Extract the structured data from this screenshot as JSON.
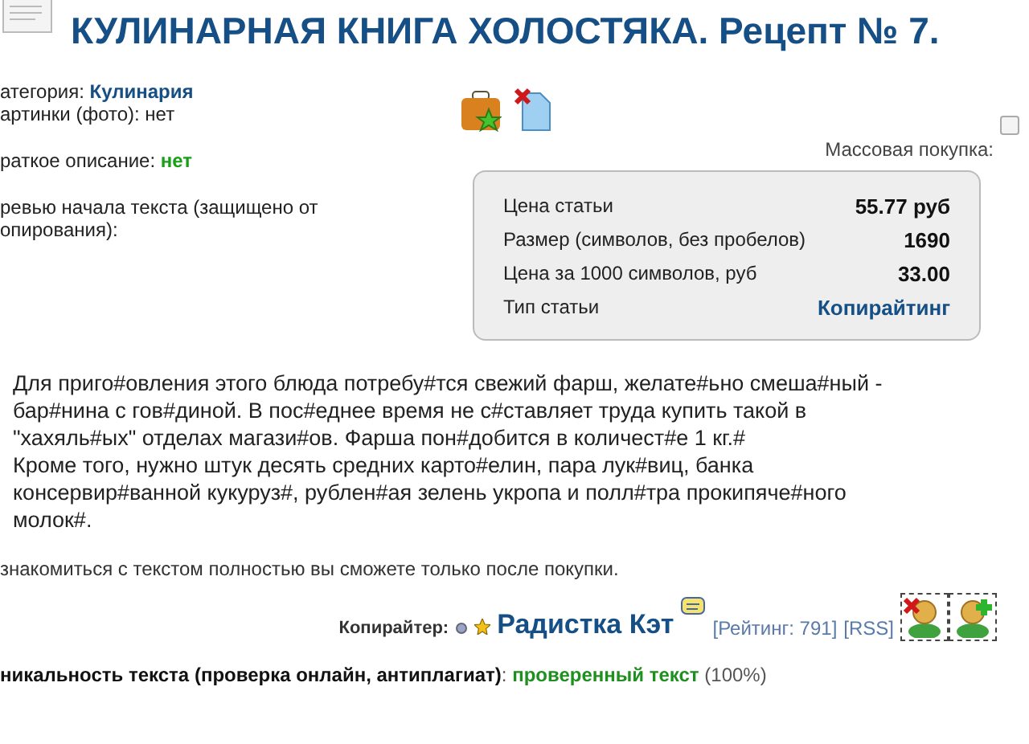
{
  "title": "КУЛИНАРНАЯ КНИГА ХОЛОСТЯКА. Рецепт № 7.",
  "info": {
    "category_label": "атегория:",
    "category": "Кулинария",
    "pictures": "артинки (фото): нет",
    "description_label": "раткое описание:",
    "description_value": "нет",
    "preview_label": "ревью начала текста (защищено от\nопирования):"
  },
  "mass_purchase": {
    "label": "Массовая покупка:",
    "checked": false
  },
  "stats": [
    {
      "label": "Цена статьи",
      "value": "55.77 руб",
      "kind": "plain"
    },
    {
      "label": "Размер (символов, без пробелов)",
      "value": "1690",
      "kind": "plain"
    },
    {
      "label": "Цена за 1000 символов, руб",
      "value": "33.00",
      "kind": "plain"
    },
    {
      "label": "Тип статьи",
      "value": "Копирайтинг",
      "kind": "link"
    }
  ],
  "preview_text": [
    "Для приго#овления этого блюда потребу#тся свежий фарш, желате#ьно смеша#ный  -",
    "бар#нина с гов#диной. В пос#еднее время не с#ставляет труда купить такой в",
    "\"хахяль#ых\" отделах магази#ов. Фарша пон#добится в количест#е 1 кг.#",
    "Кроме того, нужно штук десять средних карто#елин, пара лук#виц, банка",
    "консервир#ванной кукуруз#, рублен#ая зелень укропа и полл#тра прокипяче#ного",
    "молок#."
  ],
  "notice": "знакомиться с текстом полностью вы сможете только после покупки.",
  "copywriter": {
    "label": "Копирайтер:",
    "name": "Радистка Кэт",
    "rating": "[Рейтинг: 791]",
    "rss": "[RSS]"
  },
  "uniqueness": {
    "label": "никальность текста (проверка онлайн, антиплагиат)",
    "separator": ":",
    "value": "проверенный текст",
    "percent": "(100%)"
  }
}
